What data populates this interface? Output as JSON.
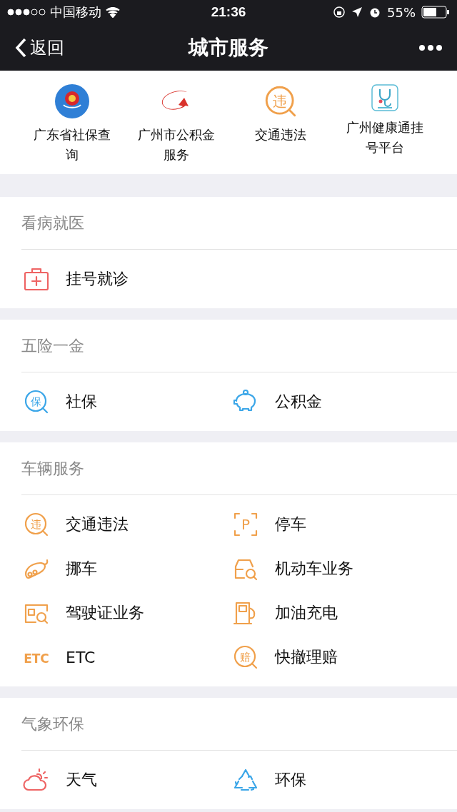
{
  "status_bar": {
    "carrier": "中国移动",
    "time": "21:36",
    "battery": "55%"
  },
  "nav": {
    "back": "返回",
    "title": "城市服务"
  },
  "shortcuts": [
    {
      "label": "广东省社保查询",
      "kind": "emblem"
    },
    {
      "label": "广州市公积金服务",
      "kind": "swoosh"
    },
    {
      "label": "交通违法",
      "kind": "violation",
      "glyph": "违"
    },
    {
      "label": "广州健康通挂号平台",
      "kind": "health"
    }
  ],
  "sections": [
    {
      "title": "看病就医",
      "items": [
        {
          "label": "挂号就诊",
          "kind": "medkit"
        }
      ]
    },
    {
      "title": "五险一金",
      "items": [
        {
          "label": "社保",
          "kind": "circle-blue",
          "glyph": "保"
        },
        {
          "label": "公积金",
          "kind": "piggy"
        }
      ]
    },
    {
      "title": "车辆服务",
      "items": [
        {
          "label": "交通违法",
          "kind": "violation",
          "glyph": "违"
        },
        {
          "label": "停车",
          "kind": "parking",
          "glyph": "P"
        },
        {
          "label": "挪车",
          "kind": "tow"
        },
        {
          "label": "机动车业务",
          "kind": "car-search"
        },
        {
          "label": "驾驶证业务",
          "kind": "license"
        },
        {
          "label": "加油充电",
          "kind": "fuel"
        },
        {
          "label": "ETC",
          "kind": "etc",
          "glyph": "ETC"
        },
        {
          "label": "快撤理赔",
          "kind": "claim",
          "glyph": "赔"
        }
      ]
    },
    {
      "title": "气象环保",
      "items": [
        {
          "label": "天气",
          "kind": "weather"
        },
        {
          "label": "环保",
          "kind": "recycle"
        }
      ]
    }
  ]
}
